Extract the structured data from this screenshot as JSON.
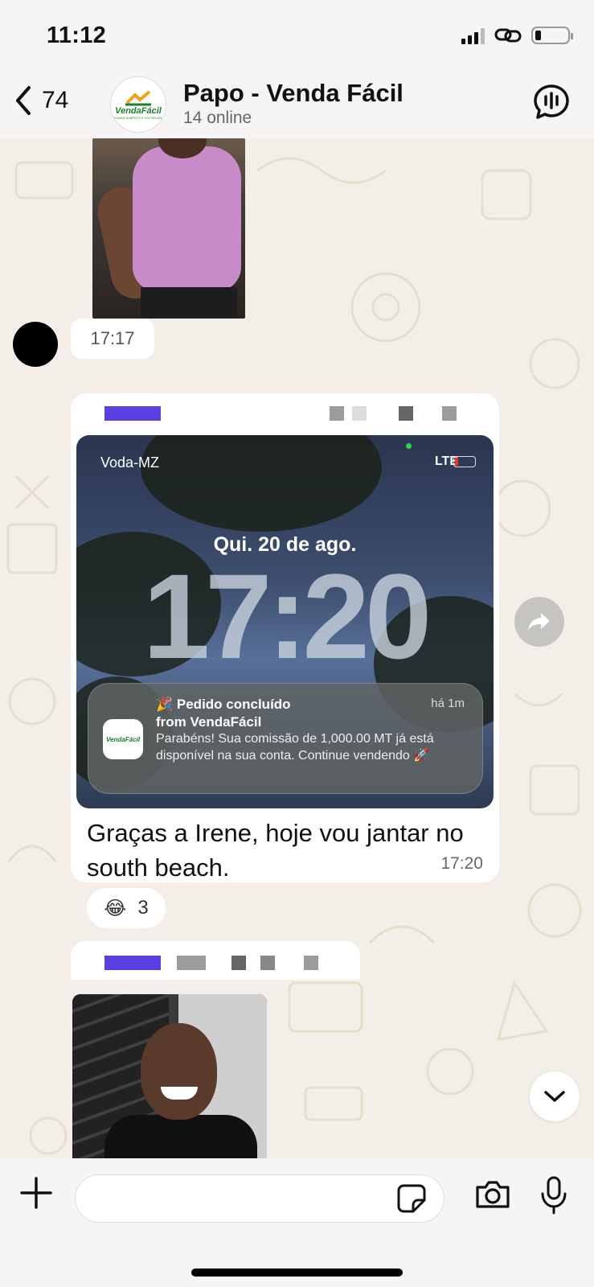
{
  "status_bar": {
    "time": "11:12"
  },
  "header": {
    "back_count": "74",
    "group_logo_text": "VendaFácil",
    "group_logo_sub": "FINANCIAMENTO E ENTREGAS",
    "title": "Papo - Venda Fácil",
    "subtitle": "14 online"
  },
  "messages": {
    "first_time": "17:17",
    "main": {
      "lockscreen": {
        "carrier": "Voda-MZ",
        "network": "LTE",
        "date": "Qui. 20 de ago.",
        "time": "17:20",
        "notification": {
          "logo_text": "VendaFácil",
          "title": "🎉 Pedido concluído",
          "from": "from VendaFácil",
          "age": "há 1m",
          "body": "Parabéns! Sua comissão de 1,000.00 MT já está disponível na sua conta. Continue vendendo 🚀"
        }
      },
      "text": "Graças a Irene, hoje vou jantar no south beach.",
      "time": "17:20"
    },
    "reaction": {
      "emoji": "😂",
      "count": "3"
    }
  },
  "colors": {
    "background": "#f3efe8",
    "bubble": "#ffffff",
    "redacted_name": "#5b3fe2"
  }
}
